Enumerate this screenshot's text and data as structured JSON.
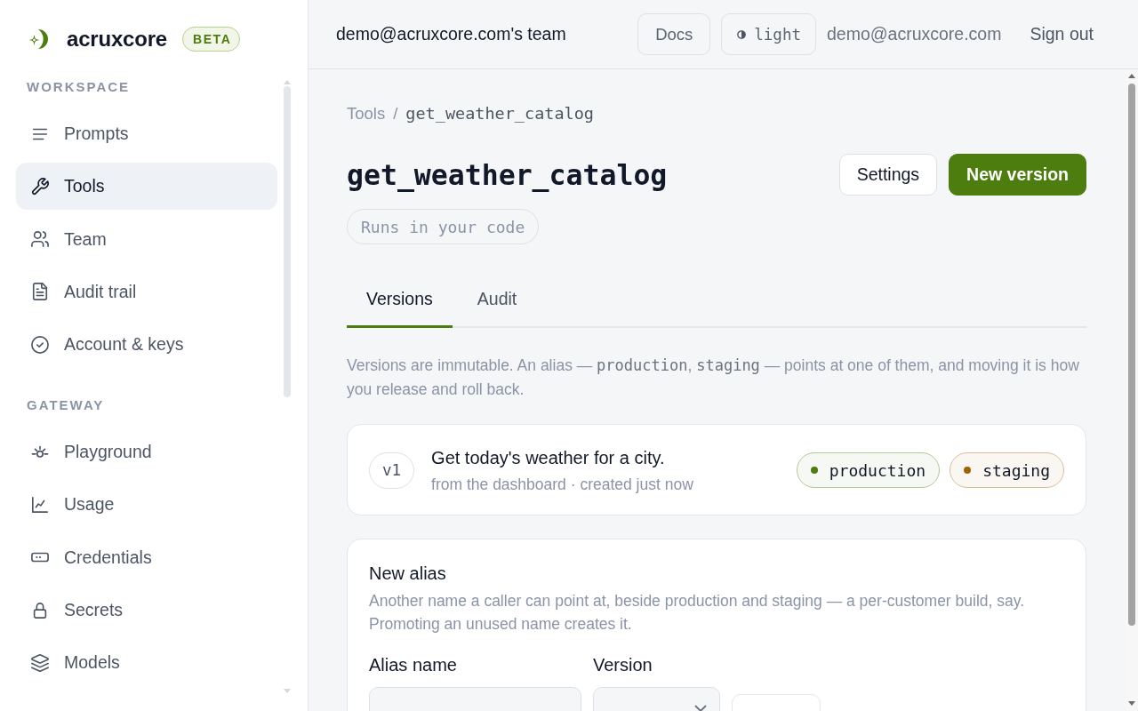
{
  "sidebar": {
    "brand": {
      "name": "acruxcore",
      "badge": "BETA"
    },
    "sections": [
      {
        "heading": "WORKSPACE",
        "items": [
          {
            "label": "Prompts",
            "selected": false
          },
          {
            "label": "Tools",
            "selected": true
          },
          {
            "label": "Team",
            "selected": false
          },
          {
            "label": "Audit trail",
            "selected": false
          },
          {
            "label": "Account & keys",
            "selected": false
          }
        ]
      },
      {
        "heading": "GATEWAY",
        "items": [
          {
            "label": "Playground",
            "selected": false
          },
          {
            "label": "Usage",
            "selected": false
          },
          {
            "label": "Credentials",
            "selected": false
          },
          {
            "label": "Secrets",
            "selected": false
          },
          {
            "label": "Models",
            "selected": false
          }
        ]
      }
    ]
  },
  "top_bar": {
    "team": "demo@acruxcore.com's team",
    "docs": "Docs",
    "theme": "light",
    "email": "demo@acruxcore.com",
    "sign_out": "Sign out"
  },
  "breadcrumb": [
    {
      "kind": "link",
      "label": "Tools"
    },
    {
      "kind": "separator",
      "label": "/"
    },
    {
      "kind": "current",
      "label": "get_weather_catalog"
    }
  ],
  "page": {
    "title": "get_weather_catalog",
    "badge": "Runs in your code",
    "actions": [
      {
        "kind": "secondary",
        "label": "Settings"
      },
      {
        "kind": "primary",
        "label": "New version"
      }
    ]
  },
  "tabs": [
    {
      "label": "Versions",
      "selected": true
    },
    {
      "label": "Audit",
      "selected": false
    }
  ],
  "intro": [
    {
      "kind": "text",
      "text": "Versions are immutable. An alias — "
    },
    {
      "kind": "code",
      "text": "production"
    },
    {
      "kind": "text",
      "text": ", "
    },
    {
      "kind": "code",
      "text": "staging"
    },
    {
      "kind": "text",
      "text": " — points at one of them, and moving it is how you release and roll back."
    }
  ],
  "versions": [
    {
      "version": "v1",
      "title": "Get today's weather for a city.",
      "meta": "from the dashboard · created just now",
      "aliases": [
        {
          "name": "production",
          "color": "#4d7c0f"
        },
        {
          "name": "staging",
          "color": "#a16207"
        }
      ]
    }
  ],
  "new_alias": {
    "title": "New alias",
    "description": "Another name a caller can point at, beside production and staging — a per-customer build, say. Promoting an unused name creates it.",
    "controls": [
      {
        "kind": "input",
        "label": "Alias name"
      },
      {
        "kind": "select",
        "label": "Version"
      },
      {
        "kind": "button"
      }
    ]
  }
}
